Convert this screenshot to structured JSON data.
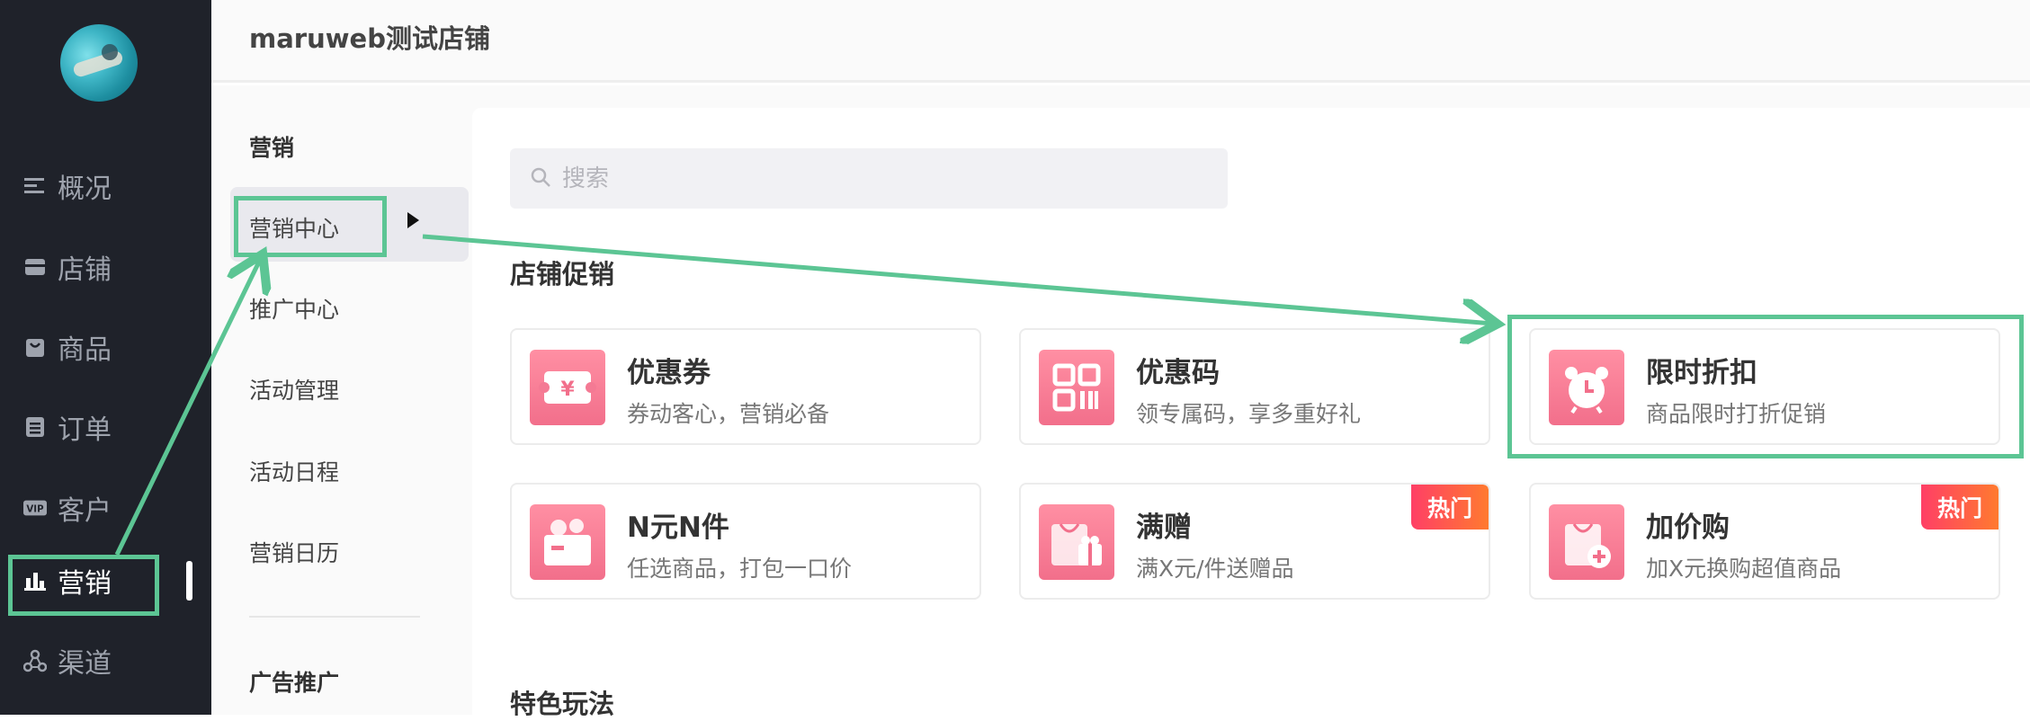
{
  "nav": {
    "items": [
      {
        "key": "overview",
        "label": "概况"
      },
      {
        "key": "store",
        "label": "店铺"
      },
      {
        "key": "goods",
        "label": "商品"
      },
      {
        "key": "orders",
        "label": "订单"
      },
      {
        "key": "customers",
        "label": "客户"
      },
      {
        "key": "marketing",
        "label": "营销"
      },
      {
        "key": "channels",
        "label": "渠道"
      }
    ],
    "active": "marketing"
  },
  "header": {
    "store_title": "maruweb测试店铺"
  },
  "subnav": {
    "group_title": "营销",
    "items": [
      "营销中心",
      "推广中心",
      "活动管理",
      "活动日程",
      "营销日历"
    ],
    "active_index": 0,
    "group2_title": "广告推广"
  },
  "main": {
    "search_placeholder": "搜索",
    "section1_title": "店铺促销",
    "section2_title": "特色玩法",
    "cards": [
      {
        "title": "优惠券",
        "desc": "券动客心，营销必备",
        "icon": "coupon-icon"
      },
      {
        "title": "优惠码",
        "desc": "领专属码，享多重好礼",
        "icon": "qr-code-icon"
      },
      {
        "title": "限时折扣",
        "desc": "商品限时打折促销",
        "icon": "alarm-clock-icon"
      },
      {
        "title": "N元N件",
        "desc": "任选商品，打包一口价",
        "icon": "bundle-box-icon"
      },
      {
        "title": "满赠",
        "desc": "满X元/件送赠品",
        "icon": "gift-bag-icon",
        "badge": "热门"
      },
      {
        "title": "加价购",
        "desc": "加X元换购超值商品",
        "icon": "add-purchase-bag-icon",
        "badge": "热门"
      }
    ]
  },
  "colors": {
    "nav_bg": "#1f222a",
    "annotation": "#5cc594",
    "card_icon": "#f26f8b",
    "hot_badge": "#ff3f66"
  }
}
